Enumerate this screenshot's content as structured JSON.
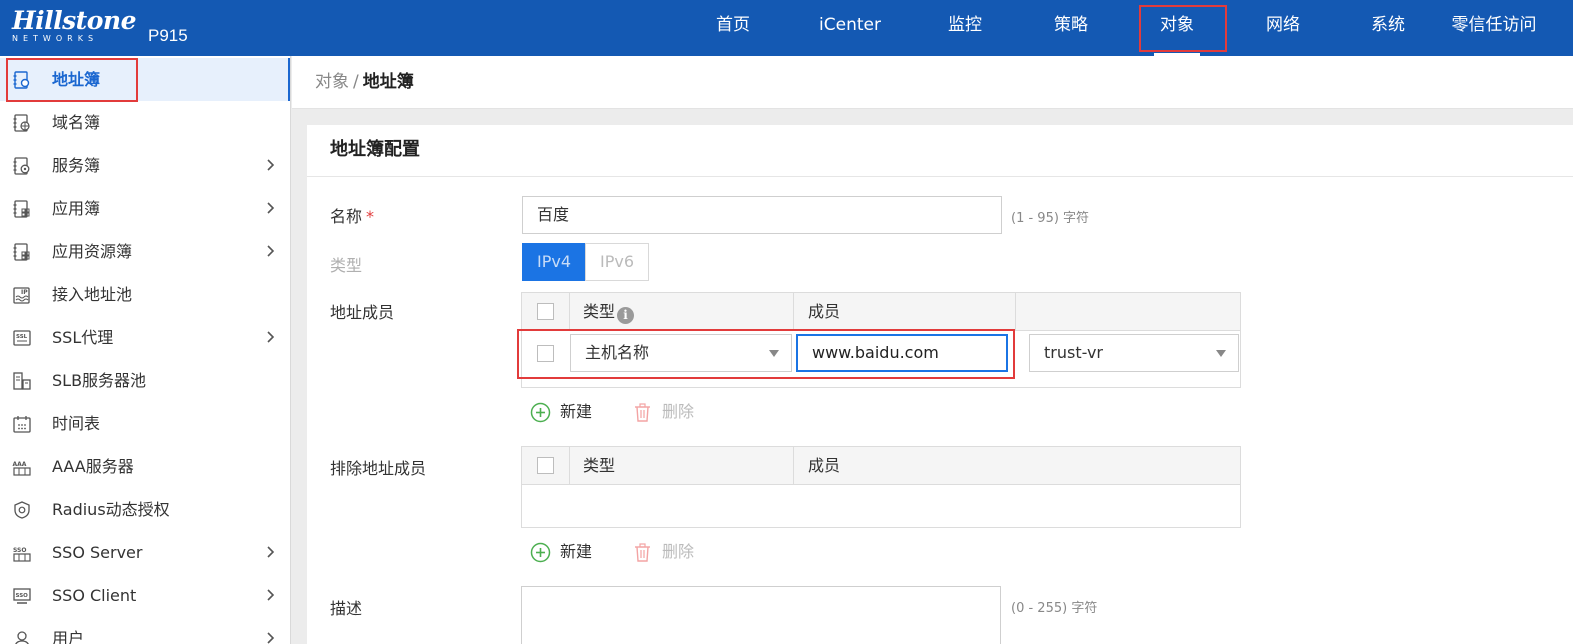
{
  "brand": {
    "logo_text": "Hillstone",
    "logo_sub": "NETWORKS",
    "model": "P915"
  },
  "topnav": [
    {
      "label": "首页"
    },
    {
      "label": "iCenter"
    },
    {
      "label": "监控"
    },
    {
      "label": "策略"
    },
    {
      "label": "对象",
      "active": true
    },
    {
      "label": "网络"
    },
    {
      "label": "系统"
    },
    {
      "label": "零信任访问"
    }
  ],
  "sidebar": {
    "items": [
      {
        "label": "地址簿",
        "icon": "address-book-icon",
        "active": true,
        "has_submenu": false
      },
      {
        "label": "域名簿",
        "icon": "domain-book-icon",
        "has_submenu": false
      },
      {
        "label": "服务簿",
        "icon": "service-book-icon",
        "has_submenu": true
      },
      {
        "label": "应用簿",
        "icon": "application-book-icon",
        "has_submenu": true
      },
      {
        "label": "应用资源簿",
        "icon": "app-resource-book-icon",
        "has_submenu": true
      },
      {
        "label": "接入地址池",
        "icon": "ip-pool-icon",
        "has_submenu": false
      },
      {
        "label": "SSL代理",
        "icon": "ssl-proxy-icon",
        "has_submenu": true
      },
      {
        "label": "SLB服务器池",
        "icon": "slb-server-pool-icon",
        "has_submenu": false
      },
      {
        "label": "时间表",
        "icon": "schedule-icon",
        "has_submenu": false
      },
      {
        "label": "AAA服务器",
        "icon": "aaa-server-icon",
        "has_submenu": false
      },
      {
        "label": "Radius动态授权",
        "icon": "radius-auth-icon",
        "has_submenu": false
      },
      {
        "label": "SSO Server",
        "icon": "sso-server-icon",
        "has_submenu": true
      },
      {
        "label": "SSO Client",
        "icon": "sso-client-icon",
        "has_submenu": true
      },
      {
        "label": "用户",
        "icon": "user-icon",
        "has_submenu": true
      }
    ]
  },
  "breadcrumb": {
    "parent": "对象",
    "separator": "/",
    "current": "地址簿"
  },
  "form": {
    "title": "地址簿配置",
    "name": {
      "label": "名称",
      "required_mark": "*",
      "value": "百度",
      "hint": "(1 - 95) 字符"
    },
    "type": {
      "label": "类型",
      "options": [
        "IPv4",
        "IPv6"
      ],
      "selected": "IPv4"
    },
    "members": {
      "label": "地址成员",
      "columns": [
        "类型",
        "成员"
      ],
      "row": {
        "type_value": "主机名称",
        "member_value": "www.baidu.com",
        "vr_value": "trust-vr"
      },
      "add_label": "新建",
      "delete_label": "删除"
    },
    "exclude_members": {
      "label": "排除地址成员",
      "columns": [
        "类型",
        "成员"
      ],
      "add_label": "新建",
      "delete_label": "删除"
    },
    "description": {
      "label": "描述",
      "value": "",
      "hint": "(0 - 255) 字符"
    }
  },
  "colors": {
    "topbar": "#1459b3",
    "accent": "#1b74e4",
    "highlight_box": "#e23b3b",
    "add_icon": "#4caf50",
    "delete_icon": "#f3a3a3"
  }
}
